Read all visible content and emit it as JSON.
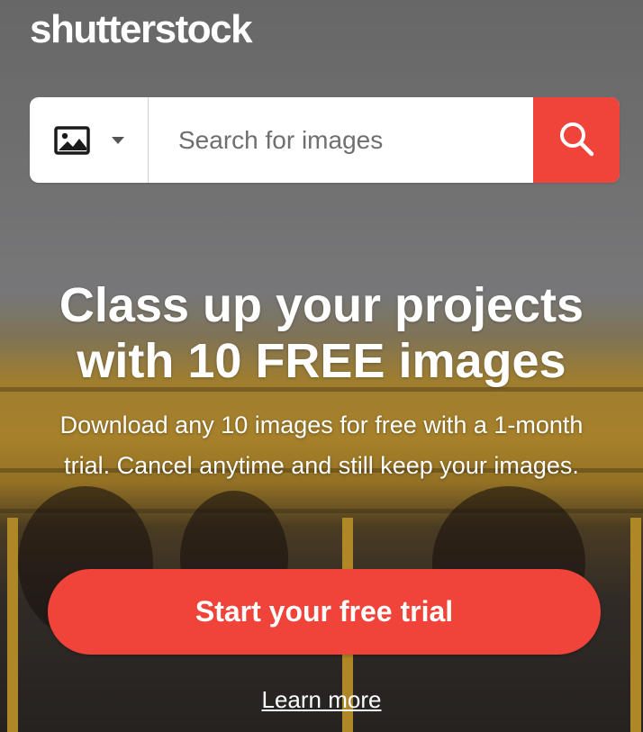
{
  "brand": {
    "logo_text": "shutterstock",
    "accent_color": "#f0433a"
  },
  "search": {
    "type_icon": "image-icon",
    "placeholder": "Search for images",
    "value": "",
    "button_icon": "search-icon"
  },
  "hero": {
    "headline": "Class up your projects with 10 FREE images",
    "subtext": "Download any 10 images for free with a 1-month trial. Cancel anytime and still keep your images."
  },
  "cta": {
    "label": "Start your free trial",
    "learn_more": "Learn more"
  }
}
